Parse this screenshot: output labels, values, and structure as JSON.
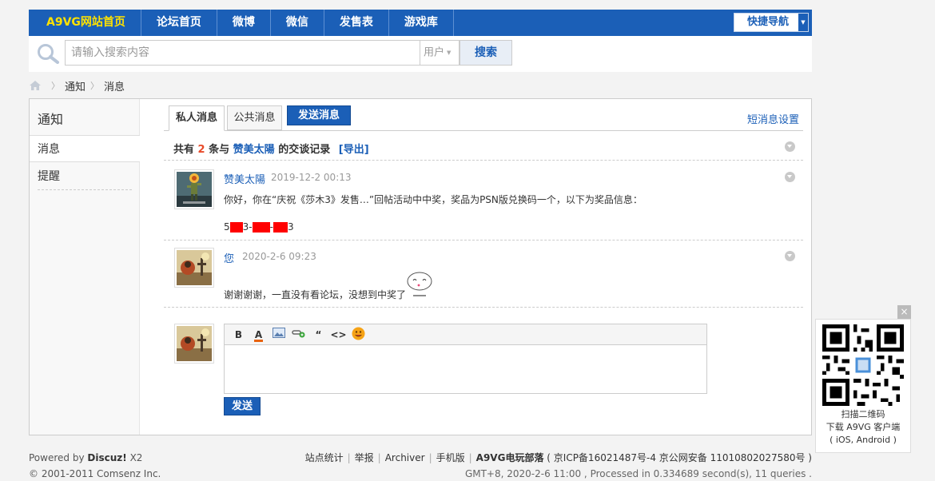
{
  "topnav": {
    "items": [
      "A9VG网站首页",
      "论坛首页",
      "微博",
      "微信",
      "发售表",
      "游戏库"
    ],
    "quick_nav": "快捷导航"
  },
  "search": {
    "placeholder": "请输入搜索内容",
    "type": "用户",
    "button": "搜索"
  },
  "breadcrumb": [
    "通知",
    "消息"
  ],
  "sidebar": {
    "title": "通知",
    "items": [
      "消息",
      "提醒"
    ]
  },
  "tabs": {
    "private": "私人消息",
    "public": "公共消息",
    "send": "发送消息",
    "settings": "短消息设置"
  },
  "summary": {
    "prefix": "共有",
    "count": "2",
    "mid": "条与",
    "user": "赞美太陽",
    "suffix": "的交谈记录",
    "export": "[导出]"
  },
  "messages": [
    {
      "name": "赞美太陽",
      "time": "2019-12-2 00:13",
      "line1": "你好，你在“庆祝《莎木3》发售…”回帖活动中中奖，奖品为PSN版兑换码一个，以下为奖品信息：",
      "code_parts": [
        "5",
        "3-",
        "-",
        "3"
      ]
    },
    {
      "name": "您",
      "time": "2020-2-6 09:23",
      "line1": "谢谢谢谢，一直没有看论坛，没想到中奖了"
    }
  ],
  "editor": {
    "tools": [
      "B",
      "A",
      "image",
      "link",
      "“",
      "<>",
      "emoji"
    ],
    "send": "发送"
  },
  "footer": {
    "powered_by": "Powered by",
    "discuz": "Discuz!",
    "version": "X2",
    "copyright": "© 2001-2011 Comsenz Inc.",
    "links": [
      "站点统计",
      "举报",
      "Archiver",
      "手机版"
    ],
    "site": "A9VG电玩部落",
    "icp": "( 京ICP备16021487号-4 京公网安备 11010802027580号 )",
    "stats": "GMT+8, 2020-2-6 11:00 , Processed in 0.334689 second(s), 11 queries ."
  },
  "qr": {
    "close": "×",
    "line1": "扫描二维码",
    "line2": "下载 A9VG 客户端",
    "line3": "( iOS, Android )"
  },
  "colors": {
    "brand": "#1b5fb7",
    "highlight": "#ffe200",
    "redact": "#ff0000"
  }
}
